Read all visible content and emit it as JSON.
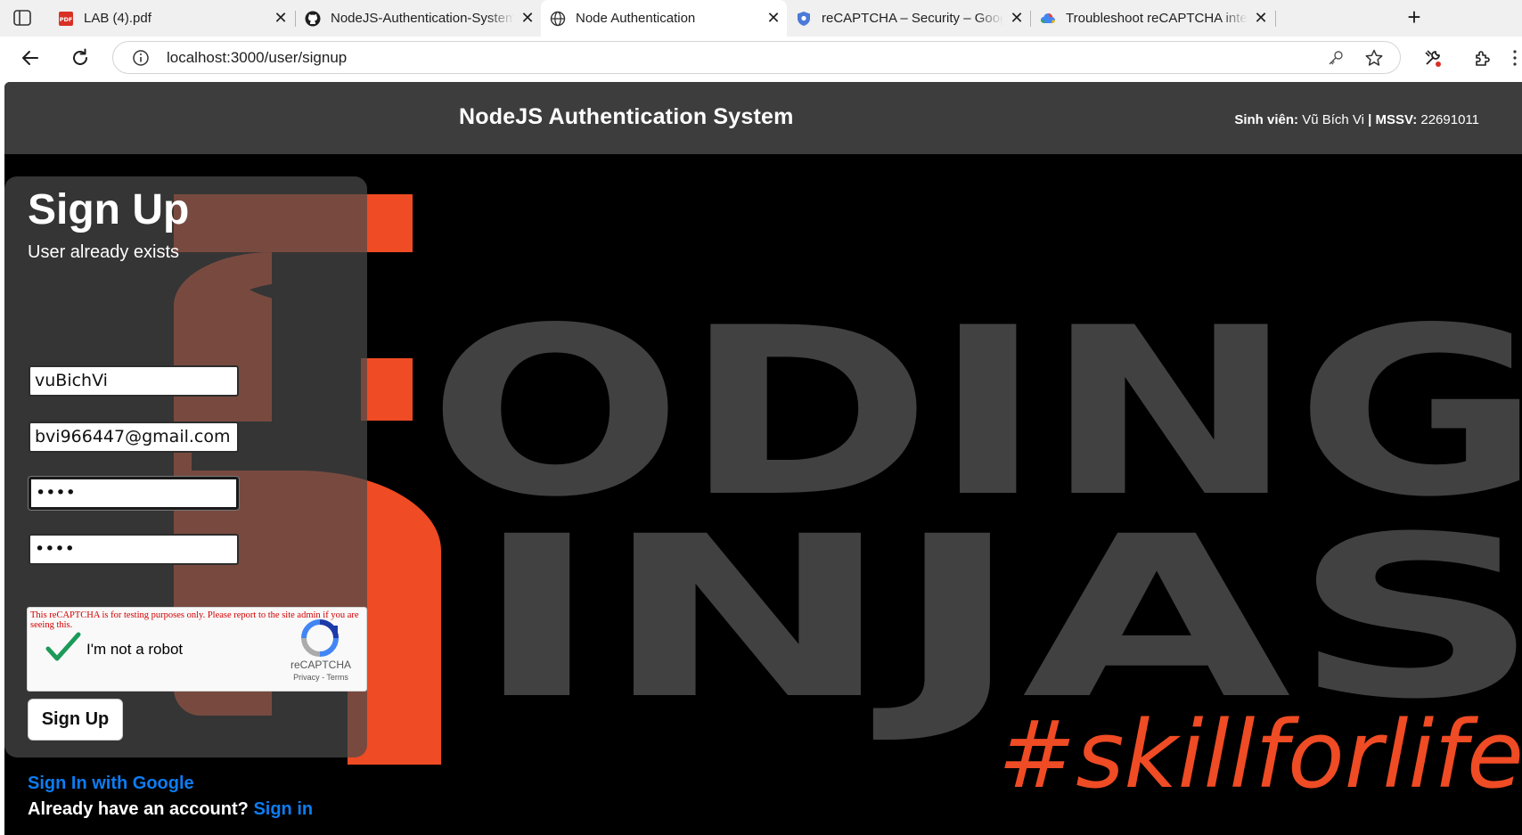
{
  "browser": {
    "tabs": [
      {
        "title": "LAB (4).pdf",
        "icon": "pdf-icon",
        "active": false
      },
      {
        "title": "NodeJS-Authentication-System/p",
        "icon": "github-icon",
        "active": false
      },
      {
        "title": "Node Authentication",
        "icon": "globe-icon",
        "active": true
      },
      {
        "title": "reCAPTCHA – Security – Google C",
        "icon": "shield-icon",
        "active": false
      },
      {
        "title": "Troubleshoot reCAPTCHA integrat",
        "icon": "google-cloud-icon",
        "active": false
      }
    ],
    "close_glyph": "✕",
    "new_tab_glyph": "+",
    "url": "localhost:3000/user/signup"
  },
  "header": {
    "title": "NodeJS Authentication System",
    "student_label": "Sinh viên:",
    "student_name": "Vũ Bích Vi",
    "separator": "|",
    "id_label": "MSSV:",
    "id_value": "22691011"
  },
  "hero": {
    "word1": "ODING",
    "word2": "INJAS",
    "tagline": "#skillforlife",
    "colors": {
      "orange": "#ef4b24",
      "gray": "#414141",
      "background": "#000000"
    }
  },
  "form": {
    "heading": "Sign Up",
    "message": "User already exists",
    "username": "vuBichVi",
    "email": "bvi966447@gmail.com",
    "password": "••••",
    "confirm_password": "••••",
    "submit_label": "Sign Up",
    "google_link": "Sign In with Google",
    "have_account": "Already have an account?",
    "signin_link": "Sign in"
  },
  "recaptcha": {
    "warning": "This reCAPTCHA is for testing purposes only. Please report to the site admin if you are seeing this.",
    "label": "I'm not a robot",
    "brand": "reCAPTCHA",
    "legal": "Privacy - Terms",
    "checked": true
  }
}
